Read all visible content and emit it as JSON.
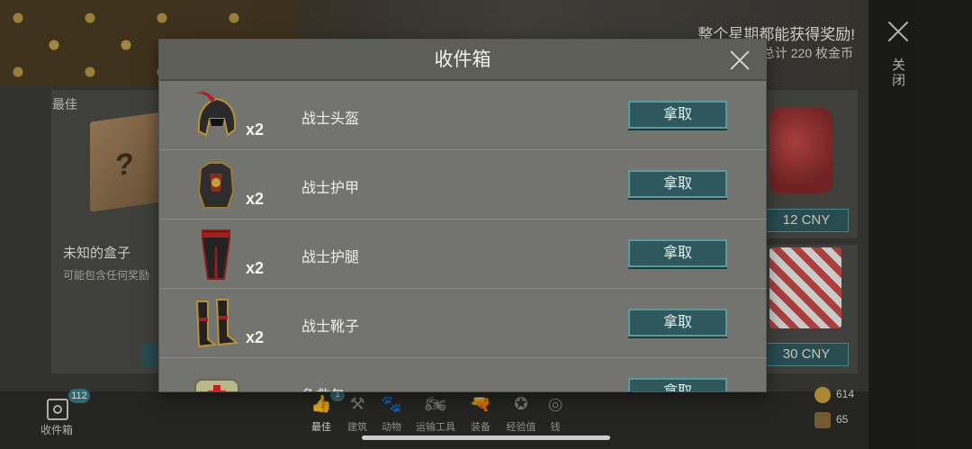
{
  "shop": {
    "promo_title": "整个星期都能获得奖励!",
    "promo_subtitle": "总计 220 枚金币",
    "close_label": "关闭",
    "best_label": "最佳",
    "box_name": "未知的盒子",
    "box_desc": "可能包含任何奖励",
    "price_1": "12 CNY",
    "price_2": "30 CNY"
  },
  "modal": {
    "title": "收件箱",
    "items": [
      {
        "name": "战士头盔",
        "qty": "x2",
        "action": "拿取",
        "icon": "warrior-helmet-icon"
      },
      {
        "name": "战士护甲",
        "qty": "x2",
        "action": "拿取",
        "icon": "warrior-armor-icon"
      },
      {
        "name": "战士护腿",
        "qty": "x2",
        "action": "拿取",
        "icon": "warrior-leggings-icon"
      },
      {
        "name": "战士靴子",
        "qty": "x2",
        "action": "拿取",
        "icon": "warrior-boots-icon"
      },
      {
        "name": "急救包",
        "qty": "",
        "action": "拿取",
        "icon": "first-aid-kit-icon"
      }
    ]
  },
  "bottom_nav": {
    "inbox_label": "收件箱",
    "inbox_badge": "112",
    "best_badge": "1",
    "items": [
      {
        "label": "最佳",
        "icon": "thumbs-up-icon"
      },
      {
        "label": "建筑",
        "icon": "hammer-icon"
      },
      {
        "label": "动物",
        "icon": "paw-icon"
      },
      {
        "label": "运输工具",
        "icon": "motorcycle-icon"
      },
      {
        "label": "装备",
        "icon": "pistol-icon"
      },
      {
        "label": "经验值",
        "icon": "xp-icon"
      },
      {
        "label": "钱",
        "icon": "coin-icon"
      }
    ]
  },
  "currency": {
    "coins": "614",
    "crates": "65"
  }
}
